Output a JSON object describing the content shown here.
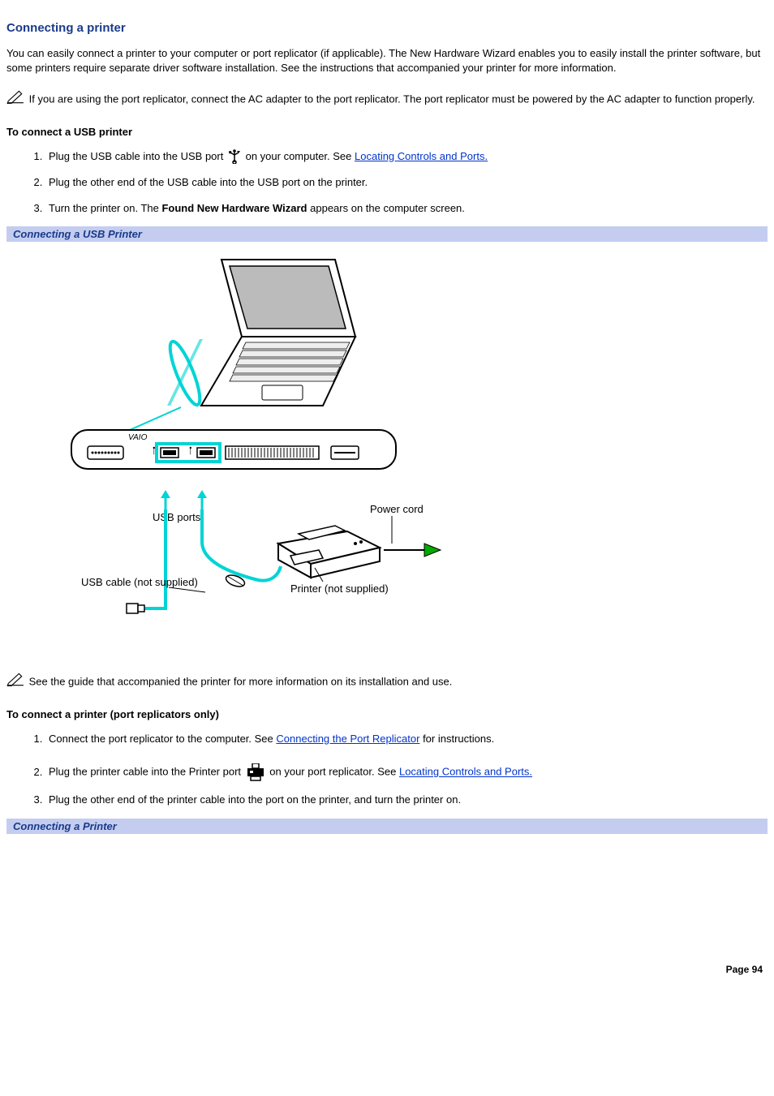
{
  "title": "Connecting a printer",
  "intro": "You can easily connect a printer to your computer or port replicator (if applicable). The New Hardware Wizard enables you to easily install the printer software, but some printers require separate driver software installation. See the instructions that accompanied your printer for more information.",
  "note1": "If you are using the port replicator, connect the AC adapter to the port replicator. The port replicator must be powered by the AC adapter to function properly.",
  "usb": {
    "heading": "To connect a USB printer",
    "step1_a": "Plug the USB cable into the USB port ",
    "step1_b": " on your computer. See ",
    "step1_link": "Locating Controls and Ports.",
    "step2": "Plug the other end of the USB cable into the USB port on the printer.",
    "step3_a": "Turn the printer on. The ",
    "step3_bold": "Found New Hardware Wizard",
    "step3_b": " appears on the computer screen.",
    "caption": "Connecting a USB Printer"
  },
  "figure": {
    "usb_ports": "USB ports",
    "power_cord": "Power cord",
    "usb_cable": "USB cable (not supplied)",
    "printer": "Printer (not supplied)",
    "vaio": "VAIO"
  },
  "note2": "See the guide that accompanied the printer for more information on its installation and use.",
  "replicator": {
    "heading": "To connect a printer (port replicators only)",
    "step1_a": "Connect the port replicator to the computer. See ",
    "step1_link": "Connecting the Port Replicator",
    "step1_b": " for instructions.",
    "step2_a": "Plug the printer cable into the Printer port ",
    "step2_b": " on your port replicator. See ",
    "step2_link": "Locating Controls and Ports.",
    "step3": "Plug the other end of the printer cable into the port on the printer, and turn the printer on.",
    "caption": "Connecting a Printer"
  },
  "page": "Page 94"
}
